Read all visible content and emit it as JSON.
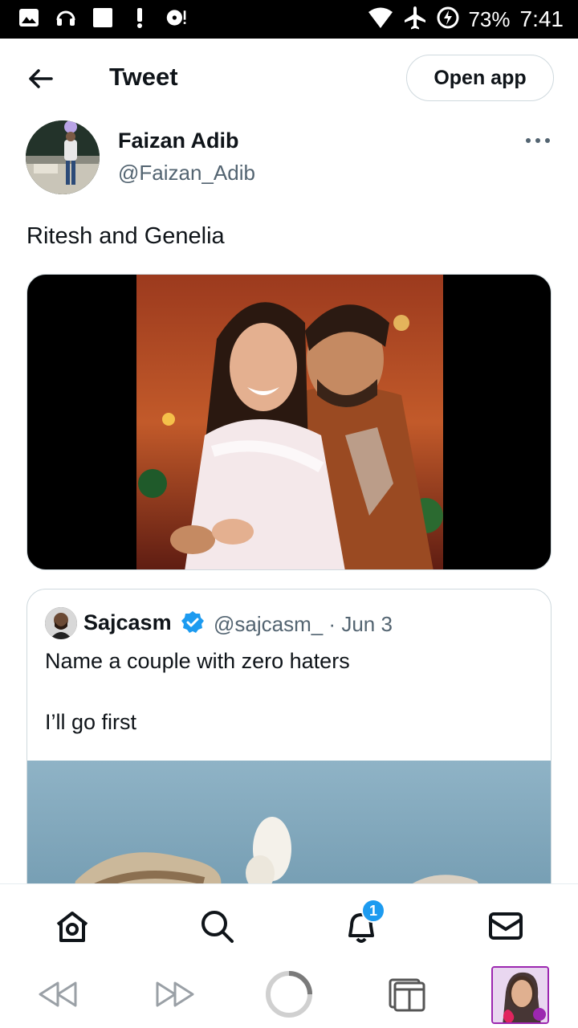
{
  "status_bar": {
    "battery": "73%",
    "time": "7:41"
  },
  "header": {
    "title": "Tweet",
    "open_app_label": "Open app"
  },
  "author": {
    "name": "Faizan Adib",
    "handle": "@Faizan_Adib"
  },
  "tweet": {
    "text": "Ritesh and Genelia"
  },
  "quoted": {
    "name": "Sajcasm",
    "handle_date": "@sajcasm_ · Jun 3",
    "line1": "Name a couple with zero haters",
    "line2": "I’ll go first"
  },
  "bottom_nav": {
    "notifications_badge": "1",
    "items": [
      "home-icon",
      "search-icon",
      "notifications-icon",
      "messages-icon"
    ]
  },
  "browser_bar": {
    "items": [
      "rewind-icon",
      "fast-forward-icon",
      "loading-icon",
      "tabs-icon"
    ]
  },
  "colors": {
    "accent": "#1d9bf0",
    "text": "#0f1419",
    "muted": "#536471",
    "border": "#cfd9de"
  }
}
